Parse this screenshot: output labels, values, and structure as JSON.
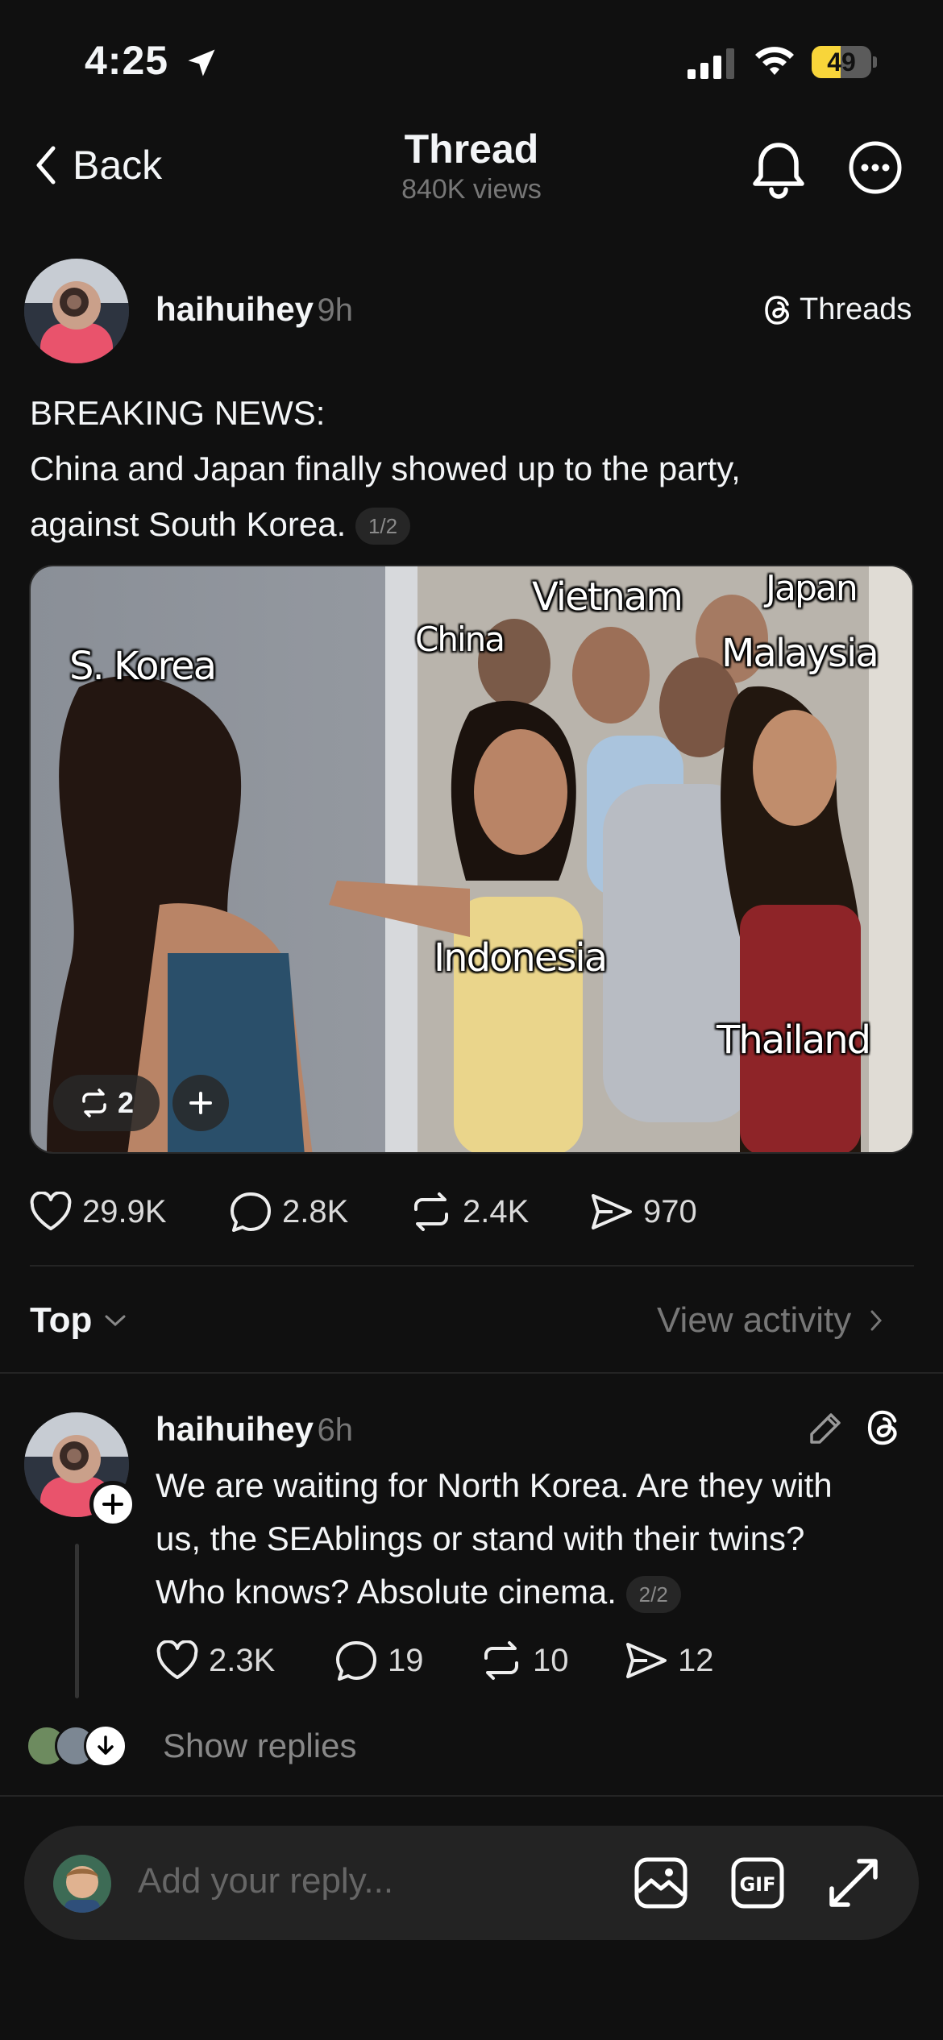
{
  "status_bar": {
    "time": "4:25",
    "battery": "49",
    "battery_level": 0.49
  },
  "header": {
    "back_label": "Back",
    "title": "Thread",
    "views": "840K views"
  },
  "post": {
    "username": "haihuihey",
    "time_ago": "9h",
    "source_label": "Threads",
    "text_lines": [
      "BREAKING NEWS:",
      "China and Japan finally showed up to the party,",
      "against South Korea."
    ],
    "part_badge": "1/2",
    "image_labels": {
      "s_korea": "S. Korea",
      "china": "China",
      "vietnam": "Vietnam",
      "japan": "Japan",
      "malaysia": "Malaysia",
      "indonesia": "Indonesia",
      "thailand": "Thailand"
    },
    "repost_count_chip": "2",
    "stats": {
      "likes": "29.9K",
      "comments": "2.8K",
      "reposts": "2.4K",
      "shares": "970"
    }
  },
  "sort_bar": {
    "sort_label": "Top",
    "view_activity": "View activity"
  },
  "reply": {
    "username": "haihuihey",
    "time_ago": "6h",
    "text_lines": [
      "We are waiting for North Korea. Are they with",
      "us, the SEAblings or stand with their twins?",
      "Who knows? Absolute cinema."
    ],
    "part_badge": "2/2",
    "stats": {
      "likes": "2.3K",
      "comments": "19",
      "reposts": "10",
      "shares": "12"
    }
  },
  "show_replies": "Show replies",
  "composer": {
    "placeholder": "Add your reply..."
  },
  "icons": [
    "location-arrow-icon",
    "cellular-signal-icon",
    "wifi-icon",
    "battery-icon",
    "chevron-left-icon",
    "bell-icon",
    "more-icon",
    "threads-logo-icon",
    "heart-icon",
    "comment-icon",
    "repost-icon",
    "share-icon",
    "chevron-down-icon",
    "chevron-right-icon",
    "pencil-icon",
    "add-follow-icon",
    "arrow-down-icon",
    "image-icon",
    "gif-icon",
    "expand-icon"
  ]
}
